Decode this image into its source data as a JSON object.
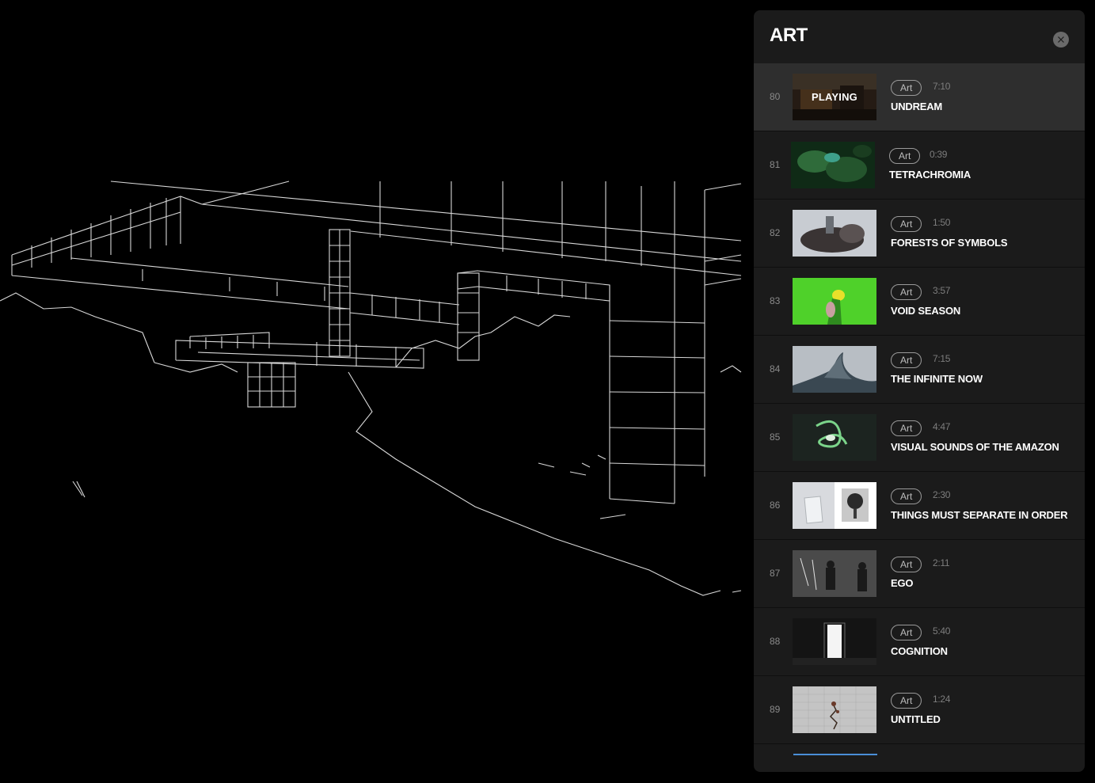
{
  "panel": {
    "title": "ART",
    "close_icon": "close-icon",
    "accent_color": "#4a8fd8",
    "items": [
      {
        "index": "80",
        "tag": "Art",
        "duration": "7:10",
        "title": "UNDREAM",
        "playing_label": "PLAYING",
        "thumb": "interior-room-photo"
      },
      {
        "index": "81",
        "tag": "Art",
        "duration": "0:39",
        "title": "TETRACHROMIA",
        "thumb": "green-foliage-photo"
      },
      {
        "index": "82",
        "tag": "Art",
        "duration": "1:50",
        "title": "FORESTS OF SYMBOLS",
        "thumb": "sculpture-photo"
      },
      {
        "index": "83",
        "tag": "Art",
        "duration": "3:57",
        "title": "VOID SEASON",
        "thumb": "green-screen-photo"
      },
      {
        "index": "84",
        "tag": "Art",
        "duration": "7:15",
        "title": "THE INFINITE NOW",
        "thumb": "wave-photo"
      },
      {
        "index": "85",
        "tag": "Art",
        "duration": "4:47",
        "title": "VISUAL SOUNDS OF THE AMAZON",
        "thumb": "swirl-render"
      },
      {
        "index": "86",
        "tag": "Art",
        "duration": "2:30",
        "title": "THINGS MUST SEPARATE IN ORDER",
        "thumb": "chair-and-fan-photo"
      },
      {
        "index": "87",
        "tag": "Art",
        "duration": "2:11",
        "title": "EGO",
        "thumb": "silhouettes-photo"
      },
      {
        "index": "88",
        "tag": "Art",
        "duration": "5:40",
        "title": "COGNITION",
        "thumb": "glowing-monolith-photo"
      },
      {
        "index": "89",
        "tag": "Art",
        "duration": "1:24",
        "title": "UNTITLED",
        "thumb": "flower-on-grid-photo"
      }
    ]
  }
}
